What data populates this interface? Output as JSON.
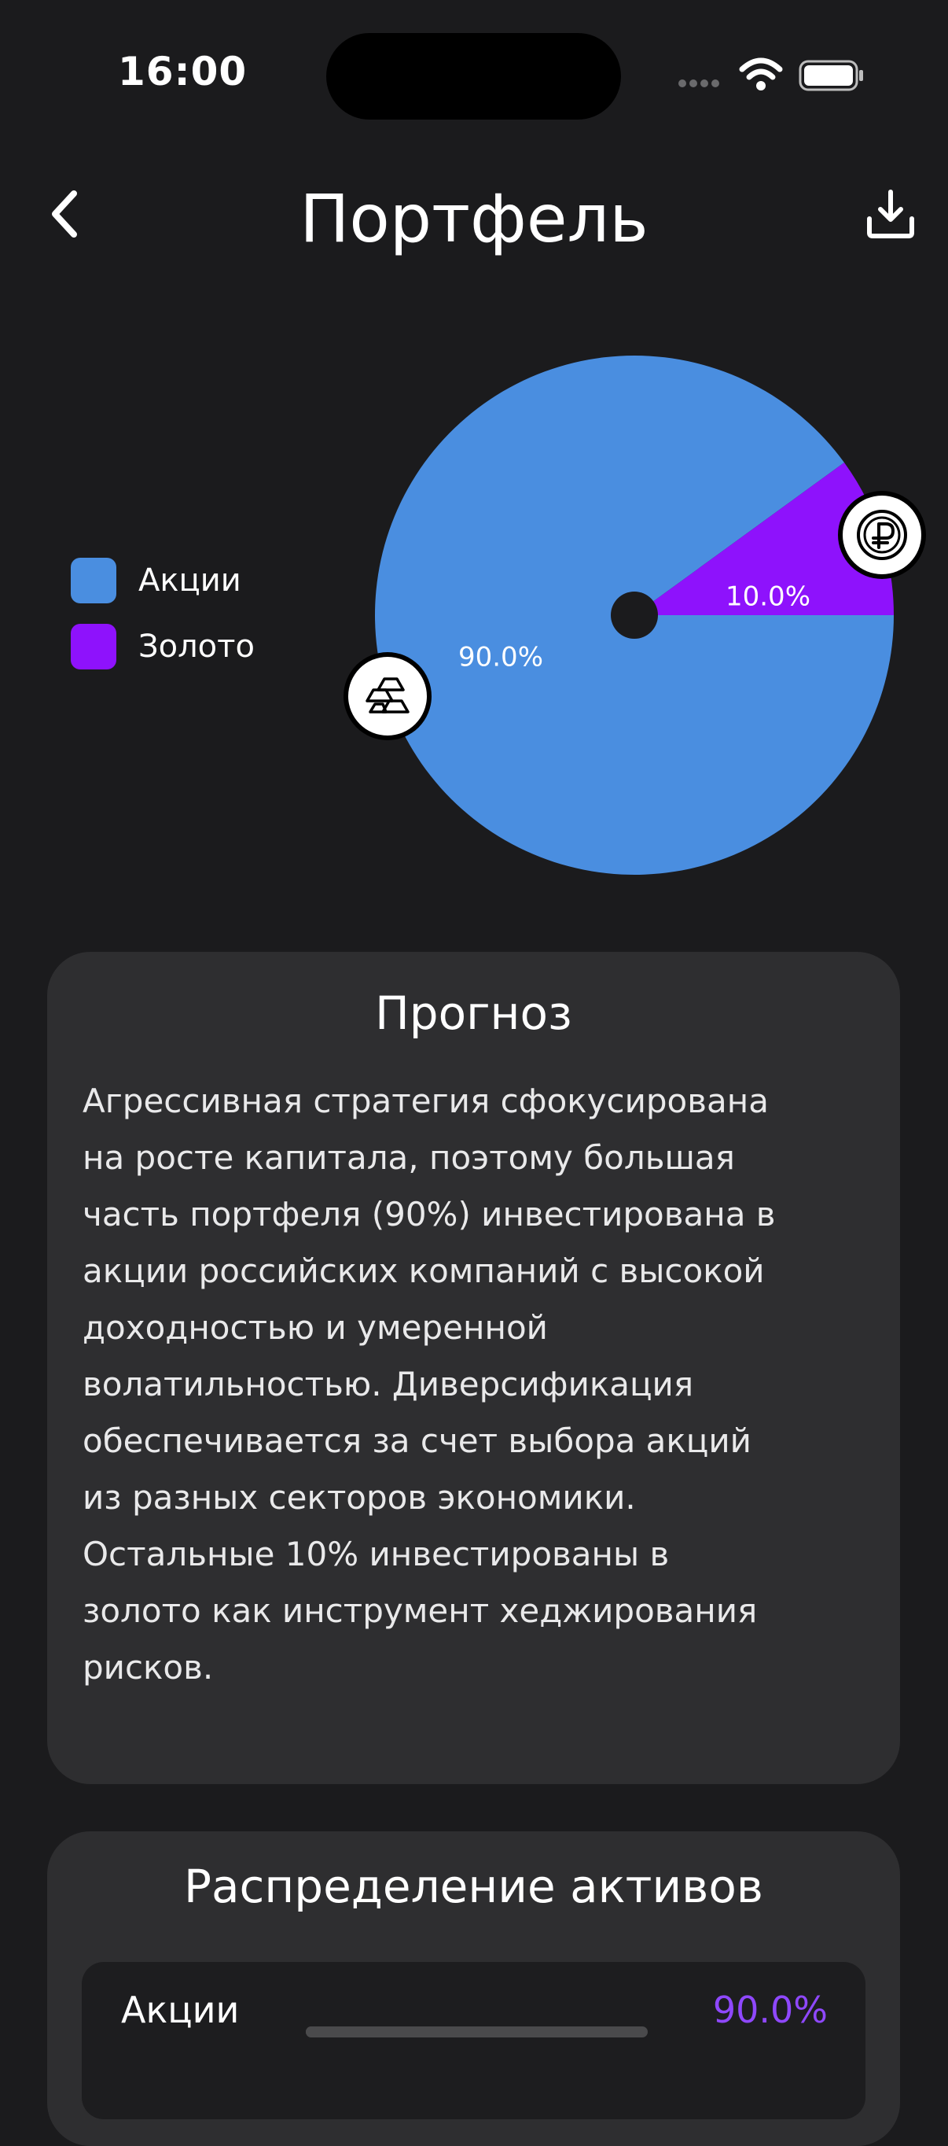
{
  "status_bar": {
    "time": "16:00"
  },
  "header": {
    "title": "Портфель"
  },
  "colors": {
    "background": "#1b1b1d",
    "card": "#2e2e30",
    "stocks": "#4a8ee0",
    "gold": "#8e12fc",
    "accent_value": "#8f48ff"
  },
  "legend": [
    {
      "label": "Акции",
      "color": "#4a8ee0"
    },
    {
      "label": "Золото",
      "color": "#8e12fc"
    }
  ],
  "chart_data": {
    "type": "pie",
    "slices": [
      {
        "label": "Акции",
        "value": 90.0,
        "display": "90.0%",
        "color": "#4a8ee0",
        "icon": "gold-bars-icon"
      },
      {
        "label": "Золото",
        "value": 10.0,
        "display": "10.0%",
        "color": "#8e12fc",
        "icon": "ruble-coin-icon"
      }
    ]
  },
  "forecast": {
    "title": "Прогноз",
    "text": "Агрессивная стратегия сфокусирована\nна росте капитала, поэтому большая\nчасть портфеля (90%) инвестирована в\nакции российских компаний с высокой\nдоходностью и умеренной\nволатильностью.  Диверсификация\nобеспечивается за счет выбора акций\nиз разных секторов экономики.\nОстальные 10% инвестированы в\nзолото как инструмент хеджирования\nрисков."
  },
  "allocation": {
    "title": "Распределение активов",
    "items": [
      {
        "name": "Акции",
        "value": "90.0%",
        "fraction": 0.9
      }
    ]
  }
}
